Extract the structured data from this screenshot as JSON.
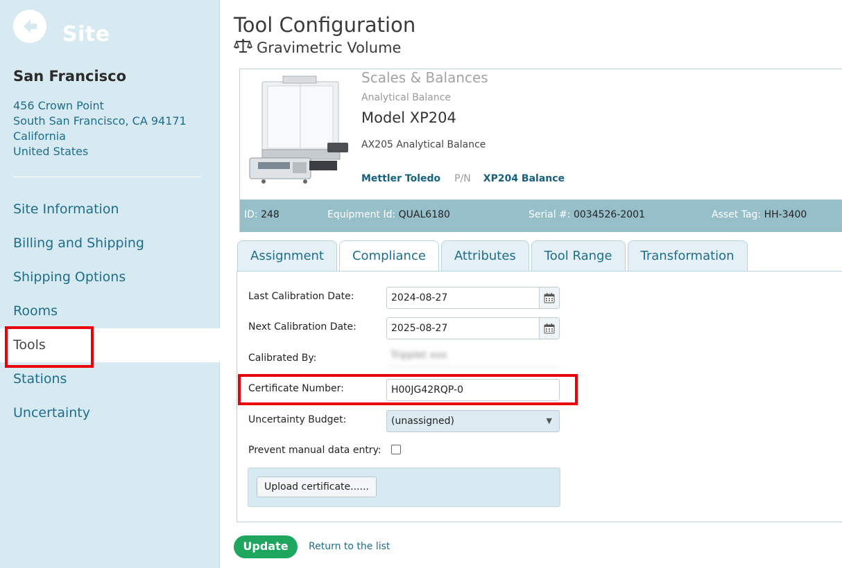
{
  "sidebar": {
    "title": "Site",
    "location_name": "San Francisco",
    "address": [
      "456 Crown Point",
      "South San Francisco, CA 94171",
      "California",
      "United States"
    ],
    "nav_items": [
      {
        "label": "Site Information"
      },
      {
        "label": "Billing and Shipping"
      },
      {
        "label": "Shipping Options"
      },
      {
        "label": "Rooms"
      },
      {
        "label": "Tools",
        "active": true
      },
      {
        "label": "Stations"
      },
      {
        "label": "Uncertainty"
      }
    ]
  },
  "header": {
    "title": "Tool Configuration",
    "subtitle": "Gravimetric Volume",
    "subtitle_icon": "scale-icon"
  },
  "tool": {
    "category": "Scales & Balances",
    "subcategory": "Analytical Balance",
    "model": "Model XP204",
    "description": "AX205 Analytical Balance",
    "manufacturer": "Mettler Toledo",
    "pn_label": "P/N",
    "pn_value": "XP204 Balance",
    "id_label": "ID:",
    "id_value": "248",
    "equipment_label": "Equipment Id:",
    "equipment_value": "QUAL6180",
    "serial_label": "Serial #:",
    "serial_value": "0034526-2001",
    "asset_label": "Asset Tag:",
    "asset_value": "HH-3400"
  },
  "tabs": [
    {
      "label": "Assignment"
    },
    {
      "label": "Compliance",
      "active": true
    },
    {
      "label": "Attributes"
    },
    {
      "label": "Tool Range"
    },
    {
      "label": "Transformation"
    }
  ],
  "form": {
    "last_cal_label": "Last Calibration Date:",
    "last_cal_value": "2024-08-27",
    "next_cal_label": "Next Calibration Date:",
    "next_cal_value": "2025-08-27",
    "calibrated_by_label": "Calibrated By:",
    "calibrated_by_value": "Tripplet xxx",
    "cert_label": "Certificate Number:",
    "cert_value": "H00JG42RQP-0",
    "budget_label": "Uncertainty Budget:",
    "budget_value": "(unassigned)",
    "prevent_label": "Prevent manual data entry:",
    "prevent_checked": false,
    "upload_label": "Upload certificate......"
  },
  "actions": {
    "update_label": "Update",
    "return_label": "Return to the list"
  },
  "colors": {
    "sidebar_bg": "#d7e9f1",
    "link": "#1d6d8c",
    "id_bar": "#96bfca",
    "update_green": "#1fa65e",
    "highlight_red": "#e8000b"
  }
}
